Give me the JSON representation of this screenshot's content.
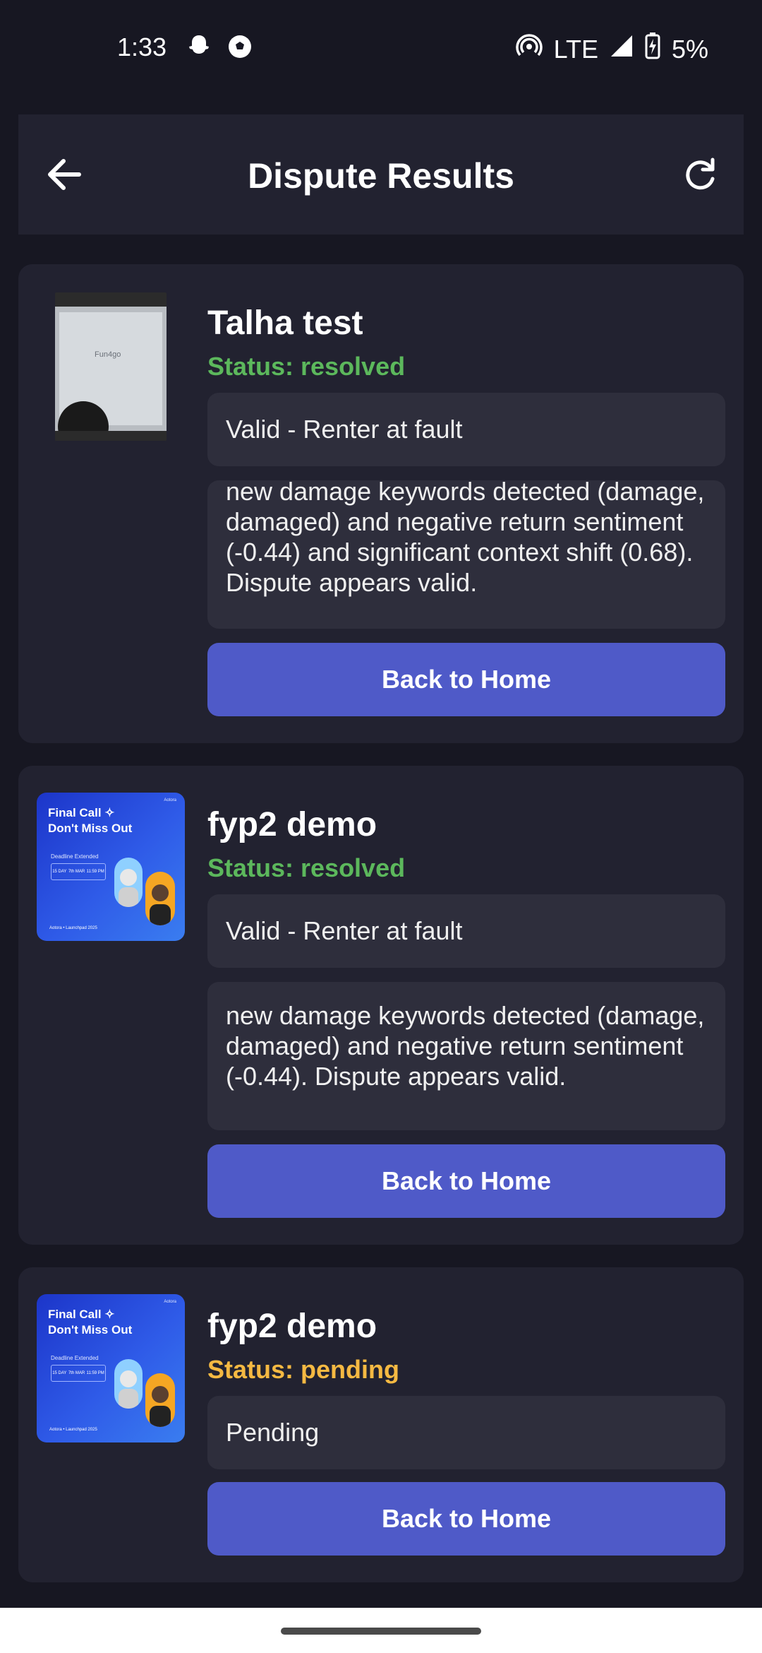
{
  "status_bar": {
    "time": "1:33",
    "network": "LTE",
    "battery": "5%",
    "icons": [
      "snapchat-icon",
      "soccer-ball-icon",
      "hotspot-icon",
      "signal-icon",
      "battery-charging-icon"
    ]
  },
  "header": {
    "title": "Dispute Results",
    "back_icon": "arrow-left-icon",
    "refresh_icon": "refresh-icon"
  },
  "colors": {
    "background": "#171722",
    "card": "#222230",
    "box": "#2e2e3c",
    "button": "#4f5ac8",
    "status_resolved": "#5cb85c",
    "status_pending": "#f5b942"
  },
  "thumbnail_text": {
    "poster_title_line1": "Final Call",
    "poster_title_line2": "Don't Miss Out",
    "poster_subtitle": "Deadline Extended",
    "poster_day": "15 DAY",
    "poster_date": "7th MAR",
    "poster_time": "11:59 PM",
    "poster_brand": "Aotora • Launchpad 2025",
    "screen_text": "Fun4go"
  },
  "disputes": [
    {
      "title": "Talha test",
      "status": "Status: resolved",
      "status_type": "resolved",
      "result": "Valid - Renter at fault",
      "reason": "new damage keywords detected (damage, damaged) and negative return sentiment (-0.44) and significant context shift (0.68). Dispute appears valid.",
      "button": "Back to Home"
    },
    {
      "title": "fyp2 demo",
      "status": "Status: resolved",
      "status_type": "resolved",
      "result": "Valid - Renter at fault",
      "reason": "new damage keywords detected (damage, damaged) and negative return sentiment (-0.44). Dispute appears valid.",
      "button": "Back to Home"
    },
    {
      "title": "fyp2 demo",
      "status": "Status: pending",
      "status_type": "pending",
      "result": "Pending",
      "button": "Back to Home"
    }
  ]
}
